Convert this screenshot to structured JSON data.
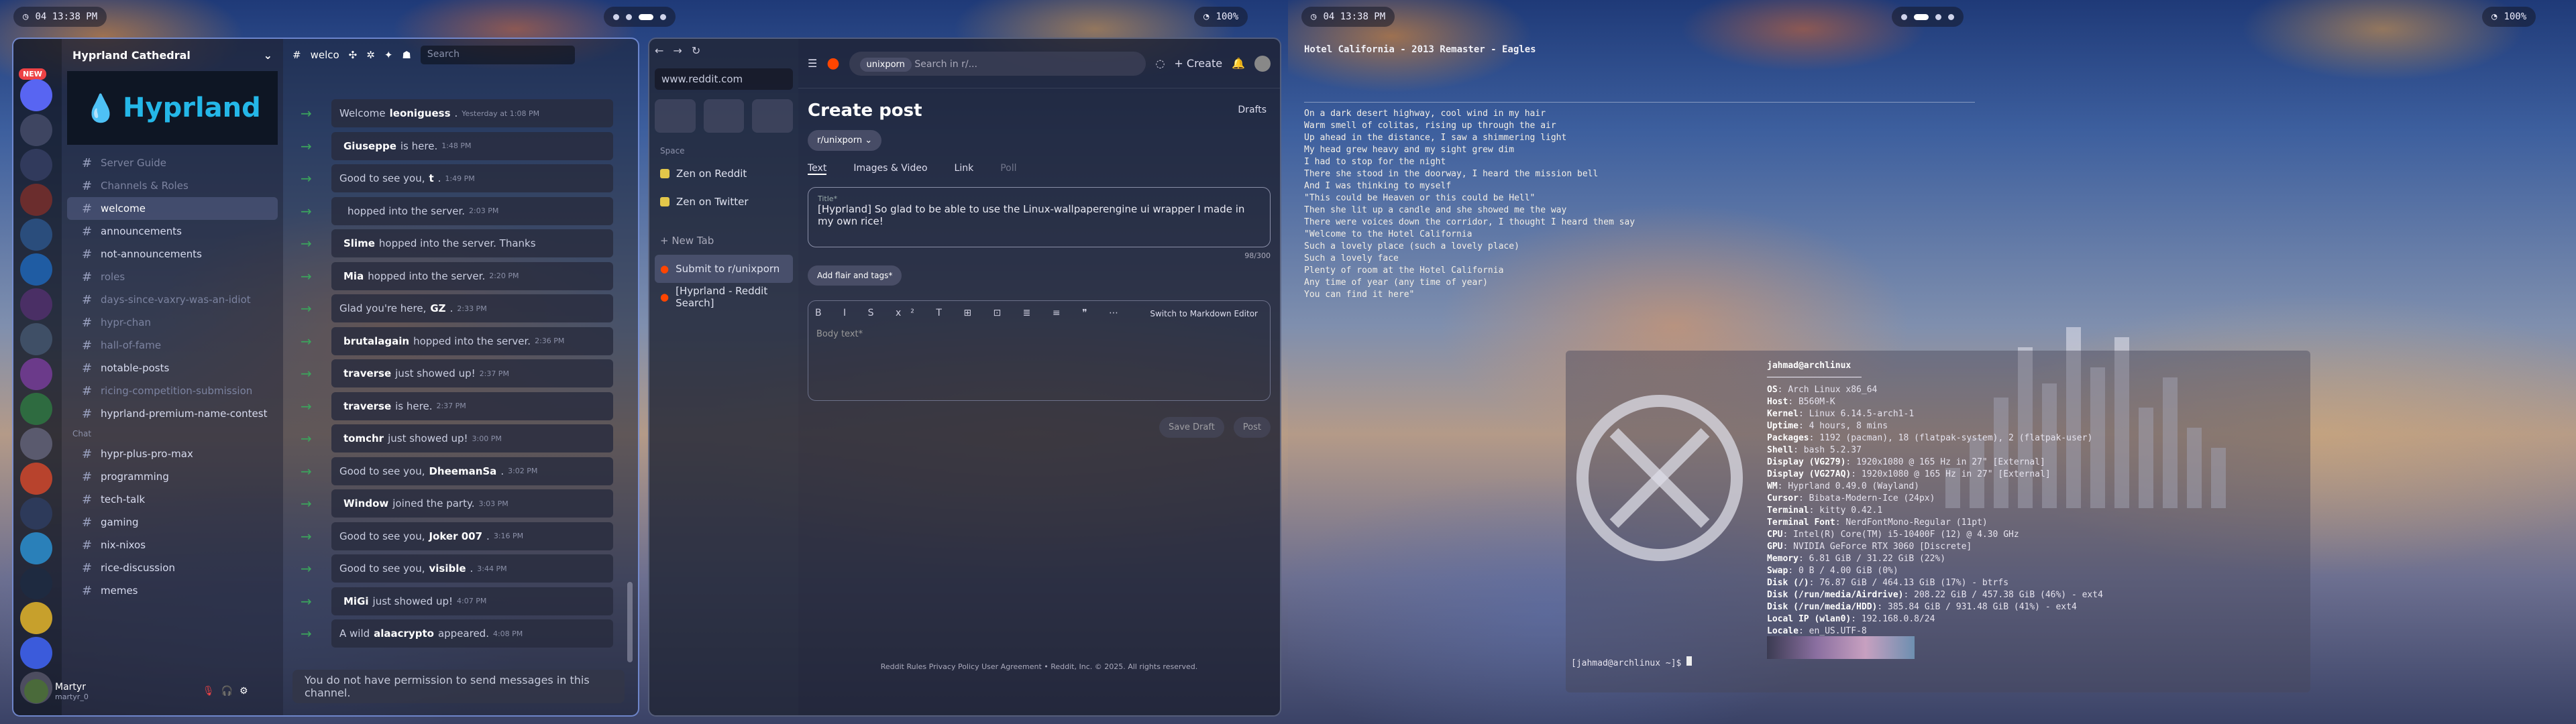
{
  "monitor_left": {
    "topbar": {
      "clock": "04 13:38 PM",
      "right": "100%"
    },
    "discord": {
      "server_name": "Hyprland Cathedral",
      "banner_text": "Hyprland",
      "header_channel": "welco",
      "search_placeholder": "Search",
      "window_title": "Hyprland Cathedral",
      "new_badge": "NEW",
      "servers": [
        "H",
        "",
        "",
        "S.",
        "",
        "",
        "",
        "",
        "",
        "",
        "",
        "",
        "",
        "",
        "",
        "",
        "",
        "",
        ""
      ],
      "channels": [
        {
          "name": "Server Guide",
          "muted": true
        },
        {
          "name": "Channels & Roles",
          "muted": true
        },
        {
          "name": "welcome",
          "active": true
        },
        {
          "name": "announcements"
        },
        {
          "name": "not-announcements"
        },
        {
          "name": "roles",
          "muted": true
        },
        {
          "name": "days-since-vaxry-was-an-idiot",
          "muted": true
        },
        {
          "name": "hypr-chan",
          "muted": true
        },
        {
          "name": "hall-of-fame",
          "muted": true
        },
        {
          "name": "notable-posts"
        },
        {
          "name": "ricing-competition-submission",
          "muted": true
        },
        {
          "name": "hyprland-premium-name-contest"
        }
      ],
      "category_chat": "Chat",
      "chat_channels": [
        "hypr-plus-pro-max",
        "programming",
        "tech-talk",
        "gaming",
        "nix-nixos",
        "rice-discussion",
        "memes"
      ],
      "messages": [
        {
          "pre": "Welcome ",
          "who": "leoniguess",
          "post": ".",
          "ts": "Yesterday at 1:08 PM"
        },
        {
          "pre": "",
          "who": "Giuseppe",
          "post": " is here.",
          "ts": "1:48 PM"
        },
        {
          "pre": "Good to see you, ",
          "who": "t",
          "post": ".",
          "ts": "1:49 PM"
        },
        {
          "pre": "",
          "who": "",
          "post": "hopped into the server.",
          "ts": "2:03 PM"
        },
        {
          "pre": "",
          "who": "Slime",
          "post": " hopped into the server. Thanks",
          "ts": ""
        },
        {
          "pre": "",
          "who": "Mia",
          "post": " hopped into the server.",
          "ts": "2:20 PM"
        },
        {
          "pre": "Glad you're here, ",
          "who": "GZ",
          "post": ".",
          "ts": "2:33 PM"
        },
        {
          "pre": "",
          "who": "brutalagain",
          "post": " hopped into the server.",
          "ts": "2:36 PM"
        },
        {
          "pre": "",
          "who": "traverse",
          "post": " just showed up!",
          "ts": "2:37 PM"
        },
        {
          "pre": "",
          "who": "traverse",
          "post": " is here.",
          "ts": "2:37 PM"
        },
        {
          "pre": "",
          "who": "tomchr",
          "post": " just showed up!",
          "ts": "3:00 PM"
        },
        {
          "pre": "Good to see you, ",
          "who": "DheemanSa",
          "post": ".",
          "ts": "3:02 PM"
        },
        {
          "pre": "",
          "who": "Window",
          "post": " joined the party.",
          "ts": "3:03 PM"
        },
        {
          "pre": "Good to see you, ",
          "who": "Joker 007",
          "post": ".",
          "ts": "3:16 PM"
        },
        {
          "pre": "Good to see you, ",
          "who": "visible",
          "post": ".",
          "ts": "3:44 PM"
        },
        {
          "pre": "",
          "who": "MiGi",
          "post": " just showed up!",
          "ts": "4:07 PM"
        },
        {
          "pre": "A wild ",
          "who": "alaacrypto",
          "post": " appeared.",
          "ts": "4:08 PM"
        }
      ],
      "no_permission": "You do not have permission to send messages in this channel.",
      "user_name": "Martyr",
      "user_tag": "martyr_0"
    },
    "browser": {
      "url": "www.reddit.com",
      "space_label": "Space",
      "sidebar_items": [
        "Zen on Reddit",
        "Zen on Twitter"
      ],
      "new_tab": "+ New Tab",
      "tabs": [
        "Submit to r/unixporn",
        "[Hyprland - Reddit Search]"
      ],
      "reddit": {
        "subreddit_chip": "unixporn",
        "search_placeholder": "Search in r/...",
        "create_label": "Create",
        "page_title": "Create post",
        "drafts": "Drafts",
        "community": "r/unixporn",
        "tabs": [
          "Text",
          "Images & Video",
          "Link",
          "Poll"
        ],
        "title_label": "Title*",
        "title_value": "[Hyprland] So glad to be able to use the Linux-wallpaperengine ui wrapper I made in my own rice!",
        "char_count": "98/300",
        "flair_button": "Add flair and tags*",
        "markdown_toggle": "Switch to Markdown Editor",
        "body_placeholder": "Body text*",
        "save_draft": "Save Draft",
        "post_button": "Post",
        "footer": "Reddit Rules   Privacy Policy   User Agreement   •   Reddit, Inc. © 2025. All rights reserved."
      }
    }
  },
  "monitor_right": {
    "topbar": {
      "clock": "04 13:38 PM",
      "right": "100%"
    },
    "lyrics_title": "Hotel California - 2013 Remaster - Eagles",
    "lyrics": [
      "On a dark desert highway, cool wind in my hair",
      "Warm smell of colitas, rising up through the air",
      "Up ahead in the distance, I saw a shimmering light",
      "My head grew heavy and my sight grew dim",
      "I had to stop for the night",
      "There she stood in the doorway, I heard the mission bell",
      "And I was thinking to myself",
      "\"This could be Heaven or this could be Hell\"",
      "Then she lit up a candle and she showed me the way",
      "There were voices down the corridor, I thought I heard them say",
      "\"Welcome to the Hotel California",
      "Such a lovely place (such a lovely place)",
      "Such a lovely face",
      "Plenty of room at the Hotel California",
      "Any time of year (any time of year)",
      "You can find it here\""
    ],
    "fastfetch": {
      "user_host": "jahmad@archlinux",
      "lines": [
        [
          "OS",
          "Arch Linux x86_64"
        ],
        [
          "Host",
          "B560M-K"
        ],
        [
          "Kernel",
          "Linux 6.14.5-arch1-1"
        ],
        [
          "Uptime",
          "4 hours, 8 mins"
        ],
        [
          "Packages",
          "1192 (pacman), 18 (flatpak-system), 2 (flatpak-user)"
        ],
        [
          "Shell",
          "bash 5.2.37"
        ],
        [
          "Display (VG279)",
          "1920x1080 @ 165 Hz in 27\" [External]"
        ],
        [
          "Display (VG27AQ)",
          "1920x1080 @ 165 Hz in 27\" [External]"
        ],
        [
          "WM",
          "Hyprland 0.49.0 (Wayland)"
        ],
        [
          "Cursor",
          "Bibata-Modern-Ice (24px)"
        ],
        [
          "Terminal",
          "kitty 0.42.1"
        ],
        [
          "Terminal Font",
          "NerdFontMono-Regular (11pt)"
        ],
        [
          "CPU",
          "Intel(R) Core(TM) i5-10400F (12) @ 4.30 GHz"
        ],
        [
          "GPU",
          "NVIDIA GeForce RTX 3060 [Discrete]"
        ],
        [
          "Memory",
          "6.81 GiB / 31.22 GiB (22%)"
        ],
        [
          "Swap",
          "0 B / 4.00 GiB (0%)"
        ],
        [
          "Disk (/)",
          "76.87 GiB / 464.13 GiB (17%) - btrfs"
        ],
        [
          "Disk (/run/media/Airdrive)",
          "208.22 GiB / 457.38 GiB (46%) - ext4"
        ],
        [
          "Disk (/run/media/HDD)",
          "385.84 GiB / 931.48 GiB (41%) - ext4"
        ],
        [
          "Local IP (wlan0)",
          "192.168.0.8/24"
        ],
        [
          "Locale",
          "en_US.UTF-8"
        ]
      ],
      "prompt": "[jahmad@archlinux ~]$ "
    },
    "visualizer_levels": [
      0.2,
      0.35,
      0.55,
      0.8,
      0.62,
      0.9,
      0.7,
      0.85,
      0.5,
      0.65,
      0.4,
      0.3
    ]
  }
}
